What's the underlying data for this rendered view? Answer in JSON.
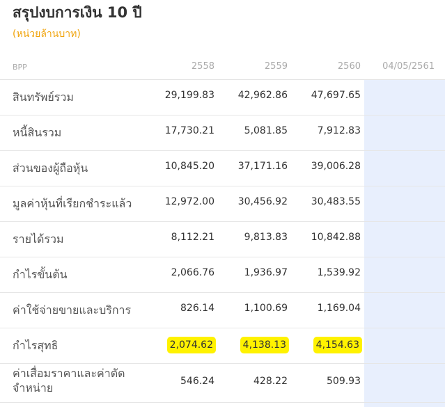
{
  "title": "สรุปงบการเงิน 10 ปี",
  "unit": "(หน่วยล้านบาท)",
  "header": {
    "label": "BPP",
    "years": [
      "2558",
      "2559",
      "2560",
      "04/05/2561"
    ]
  },
  "highlight_color": "#fff200",
  "accent_color": "#f0a30a",
  "shade_color": "#e8effd",
  "rows": [
    {
      "label": "สินทรัพย์รวม",
      "values": [
        "29,199.83",
        "42,962.86",
        "47,697.65"
      ]
    },
    {
      "label": "หนี้สินรวม",
      "values": [
        "17,730.21",
        "5,081.85",
        "7,912.83"
      ]
    },
    {
      "label": "ส่วนของผู้ถือหุ้น",
      "values": [
        "10,845.20",
        "37,171.16",
        "39,006.28"
      ]
    },
    {
      "label": "มูลค่าหุ้นที่เรียกชำระแล้ว",
      "values": [
        "12,972.00",
        "30,456.92",
        "30,483.55"
      ]
    },
    {
      "label": "รายได้รวม",
      "values": [
        "8,112.21",
        "9,813.83",
        "10,842.88"
      ]
    },
    {
      "label": "กำไรขั้นต้น",
      "values": [
        "2,066.76",
        "1,936.97",
        "1,539.92"
      ]
    },
    {
      "label": "ค่าใช้จ่ายขายและบริการ",
      "values": [
        "826.14",
        "1,100.69",
        "1,169.04"
      ]
    },
    {
      "label": "กำไรสุทธิ",
      "values": [
        "2,074.62",
        "4,138.13",
        "4,154.63"
      ],
      "highlighted": true
    },
    {
      "label_line1": "ค่าเสื่อมราคาและค่าตัด",
      "label_line2": "จำหน่าย",
      "values": [
        "546.24",
        "428.22",
        "509.93"
      ]
    }
  ]
}
